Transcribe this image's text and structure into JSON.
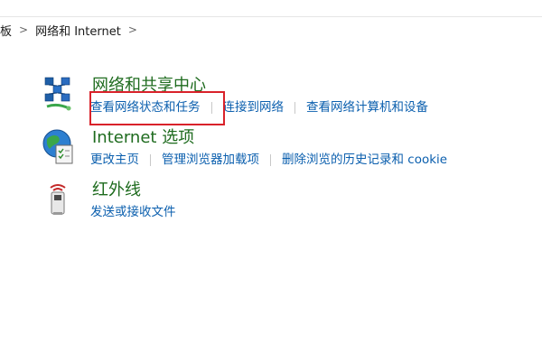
{
  "breadcrumb": {
    "items": [
      "板",
      "网络和 Internet"
    ],
    "separator": ">",
    "trailing": ">"
  },
  "categories": [
    {
      "title": "网络和共享中心",
      "icon": "network-sharing-center-icon",
      "links": [
        "查看网络状态和任务",
        "连接到网络",
        "查看网络计算机和设备"
      ]
    },
    {
      "title": "Internet 选项",
      "icon": "internet-options-globe-icon",
      "links": [
        "更改主页",
        "管理浏览器加载项",
        "删除浏览的历史记录和 cookie"
      ]
    },
    {
      "title": "红外线",
      "icon": "infrared-icon",
      "links": [
        "发送或接收文件"
      ]
    }
  ],
  "colors": {
    "title_green": "#1e6b1e",
    "link_blue": "#0b5fae",
    "highlight_red": "#d9222a"
  }
}
